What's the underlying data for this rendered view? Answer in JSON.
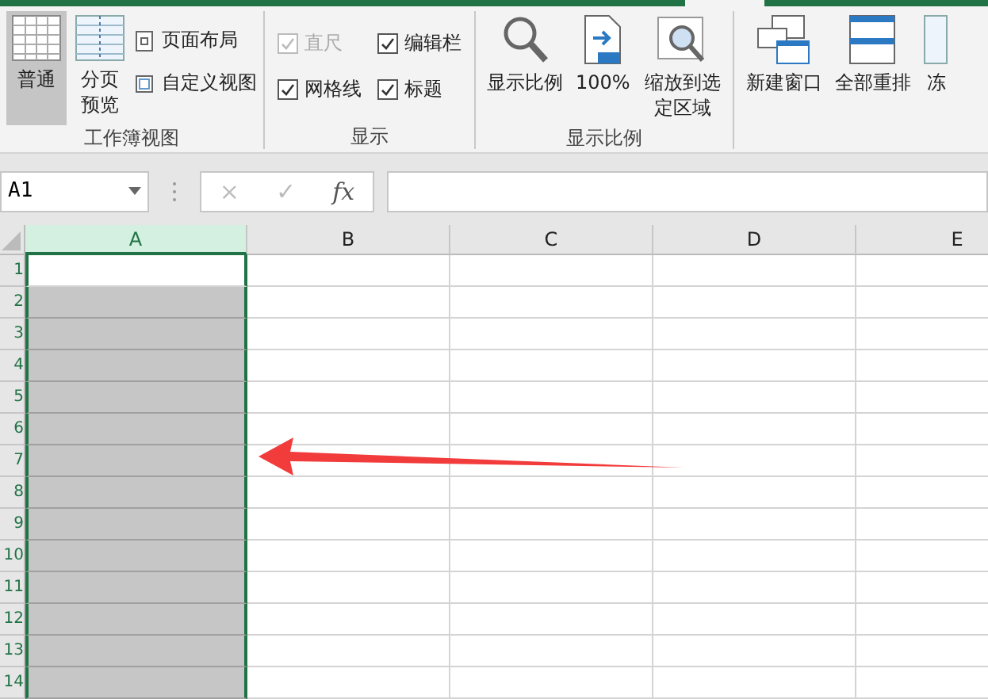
{
  "ribbon": {
    "groups": [
      {
        "label": "工作簿视图",
        "items": [
          {
            "kind": "large",
            "label": "普通",
            "selected": true
          },
          {
            "kind": "large",
            "label": "分页预览",
            "selected": false
          },
          {
            "kind": "small",
            "label": "页面布局"
          },
          {
            "kind": "small",
            "label": "自定义视图"
          }
        ]
      },
      {
        "label": "显示",
        "items": [
          {
            "kind": "checkbox",
            "label": "直尺",
            "checked": true,
            "disabled": true
          },
          {
            "kind": "checkbox",
            "label": "编辑栏",
            "checked": true,
            "disabled": false
          },
          {
            "kind": "checkbox",
            "label": "网格线",
            "checked": true,
            "disabled": false
          },
          {
            "kind": "checkbox",
            "label": "标题",
            "checked": true,
            "disabled": false
          }
        ]
      },
      {
        "label": "显示比例",
        "items": [
          {
            "kind": "large",
            "label": "显示比例",
            "selected": false
          },
          {
            "kind": "large",
            "label": "100%",
            "selected": false
          },
          {
            "kind": "large",
            "label": "缩放到选定区域",
            "selected": false
          }
        ]
      },
      {
        "items": [
          {
            "kind": "large",
            "label": "新建窗口",
            "selected": false
          },
          {
            "kind": "large",
            "label": "全部重排",
            "selected": false
          },
          {
            "kind": "large",
            "label": "冻",
            "selected": false
          }
        ]
      }
    ]
  },
  "formula_bar": {
    "name_box": "A1",
    "cancel": "×",
    "enter": "✓",
    "function": "fx"
  },
  "sheet": {
    "columns": [
      {
        "label": "A",
        "selected": true
      },
      {
        "label": "B",
        "selected": false
      },
      {
        "label": "C",
        "selected": false
      },
      {
        "label": "D",
        "selected": false
      },
      {
        "label": "E",
        "selected": false
      }
    ],
    "rows": [
      "1",
      "2",
      "3",
      "4",
      "5",
      "6",
      "7",
      "8",
      "9",
      "10",
      "11",
      "12",
      "13",
      "14"
    ]
  },
  "annotation": {
    "kind": "arrow"
  }
}
